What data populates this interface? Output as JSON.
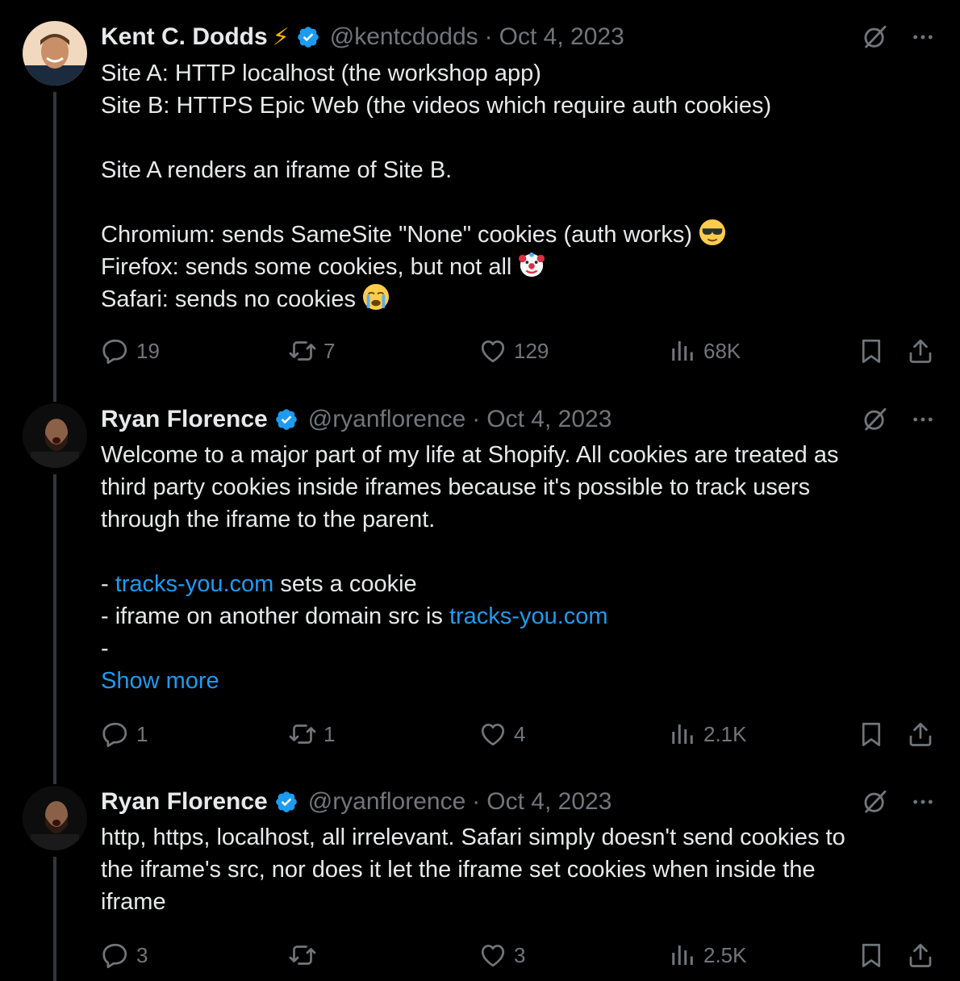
{
  "tweets": [
    {
      "name": "Kent C. Dodds",
      "has_bolt": true,
      "bolt": "⚡",
      "handle": "@kentcdodds",
      "separator": "·",
      "date": "Oct 4, 2023",
      "lines": [
        [
          "Site A: HTTP localhost (the workshop app)"
        ],
        [
          "Site B: HTTPS Epic Web (the videos which require auth cookies)"
        ],
        [
          ""
        ],
        [
          "Site A renders an iframe of Site B."
        ],
        [
          ""
        ],
        [
          "Chromium: sends SameSite \"None\" cookies (auth works) "
        ],
        [
          "Firefox: sends some cookies, but not all "
        ],
        [
          "Safari: sends no cookies "
        ]
      ],
      "emojis": [
        "sunglasses-emoji",
        "clown-emoji",
        "crying-emoji"
      ],
      "stats": {
        "replies": "19",
        "reposts": "7",
        "likes": "129",
        "views": "68K"
      }
    },
    {
      "name": "Ryan Florence",
      "handle": "@ryanflorence",
      "separator": "·",
      "date": "Oct 4, 2023",
      "lines": [
        "Welcome to a major part of my life at Shopify. All cookies are treated as",
        "third party cookies inside iframes because it's possible to track users",
        "through the iframe to the parent.",
        "",
        "- ",
        "- iframe on another domain src is ",
        "-"
      ],
      "link_text": "tracks-you.com",
      "line5_after": " sets a cookie",
      "show_more": "Show more",
      "stats": {
        "replies": "1",
        "reposts": "1",
        "likes": "4",
        "views": "2.1K"
      }
    },
    {
      "name": "Ryan Florence",
      "handle": "@ryanflorence",
      "separator": "·",
      "date": "Oct 4, 2023",
      "lines": [
        "http, https, localhost, all irrelevant. Safari simply doesn't send cookies to",
        "the iframe's src, nor does it let the iframe set cookies when inside the",
        "iframe"
      ],
      "stats": {
        "replies": "3",
        "reposts": "",
        "likes": "3",
        "views": "2.5K"
      }
    }
  ],
  "colors": {
    "background": "#000000",
    "text": "#e7e9ea",
    "muted": "#71767b",
    "link": "#1d9bf0",
    "verified": "#1d9bf0",
    "thread_line": "#333639"
  },
  "icons": [
    "verified-badge-icon",
    "grok-icon",
    "more-icon",
    "reply-icon",
    "repost-icon",
    "like-icon",
    "views-icon",
    "bookmark-icon",
    "share-icon"
  ]
}
